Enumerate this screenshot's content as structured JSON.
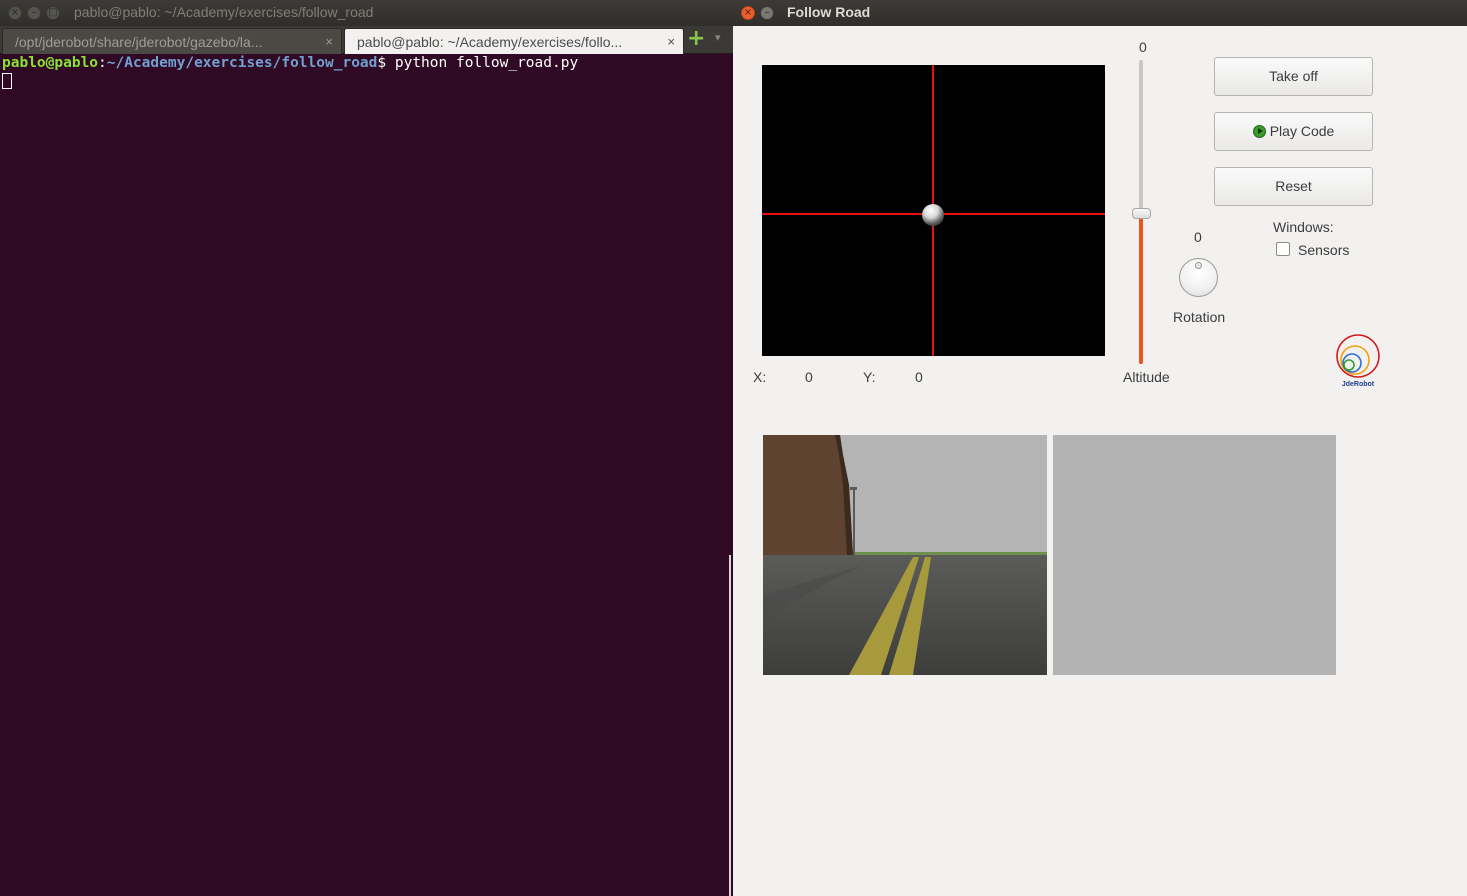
{
  "terminal": {
    "title": "pablo@pablo: ~/Academy/exercises/follow_road",
    "tabs": [
      {
        "label": "/opt/jderobot/share/jderobot/gazebo/la...",
        "close": "×"
      },
      {
        "label": "pablo@pablo: ~/Academy/exercises/follo...",
        "close": "×"
      }
    ],
    "add_tab": "+",
    "tab_menu": "▾",
    "prompt_user": "pablo@pablo",
    "prompt_sep": ":",
    "prompt_path": "~/Academy/exercises/follow_road",
    "prompt_dollar": "$ ",
    "command": "python follow_road.py"
  },
  "app": {
    "title": "Follow Road",
    "close_glyph": "×",
    "min_glyph": "–",
    "crosspad": {
      "x_label": "X:",
      "x_value": "0",
      "y_label": "Y:",
      "y_value": "0"
    },
    "altitude": {
      "value": "0",
      "label": "Altitude",
      "level": 0.5
    },
    "rotation": {
      "value": "0",
      "label": "Rotation"
    },
    "buttons": {
      "take_off": "Take off",
      "play_code": "Play Code",
      "reset": "Reset"
    },
    "windows": {
      "label": "Windows:",
      "sensors_label": "Sensors",
      "sensors_checked": false
    },
    "logo_text": "JdeRobot",
    "colors": {
      "accent": "#e95420",
      "crosshair": "#e81010",
      "terminal_bg": "#300a24"
    }
  }
}
